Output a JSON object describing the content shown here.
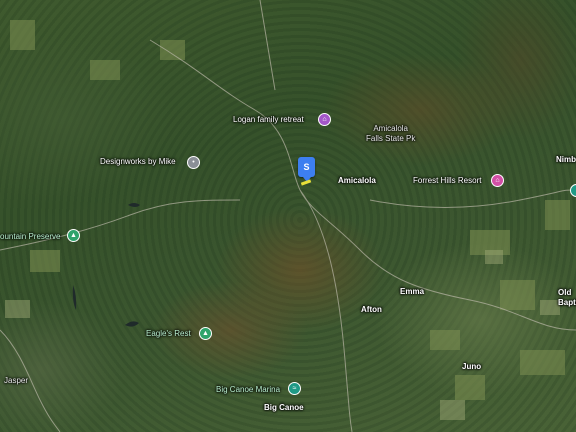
{
  "map": {
    "places": {
      "amicalola": "Amicalola",
      "afton": "Afton",
      "emma": "Emma",
      "juno": "Juno",
      "big_canoe": "Big Canoe",
      "jasper": "Jasper",
      "nimb": "Nimb",
      "old_bapti": "Old\nBapti"
    },
    "pois": {
      "logan": "Logan family retreat",
      "amicalola_falls": "Amicalola\nFalls State Pk",
      "designworks": "Designworks by Mike",
      "forrest_hills": "Forrest Hills Resort",
      "mountain_preserve": "ountain Preserve",
      "eagles_rest": "Eagle's Rest",
      "big_canoe_marina": "Big Canoe Marina"
    },
    "marker_letter": "S"
  }
}
